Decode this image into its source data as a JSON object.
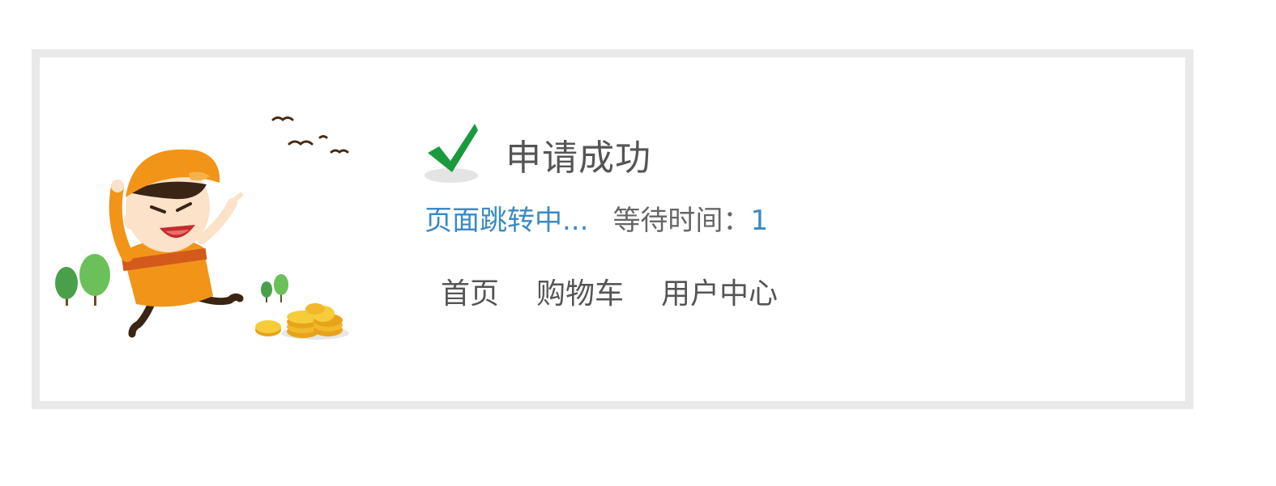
{
  "status": {
    "title": "申请成功",
    "icon": "checkmark-icon",
    "icon_color": "#1a9a3c"
  },
  "redirect": {
    "text": "页面跳转中...",
    "wait_label": "等待时间：",
    "wait_seconds": "1",
    "link_color": "#3a8ac4"
  },
  "nav": {
    "home": "首页",
    "cart": "购物车",
    "user_center": "用户中心"
  },
  "illustration": "running-worker-illustration"
}
